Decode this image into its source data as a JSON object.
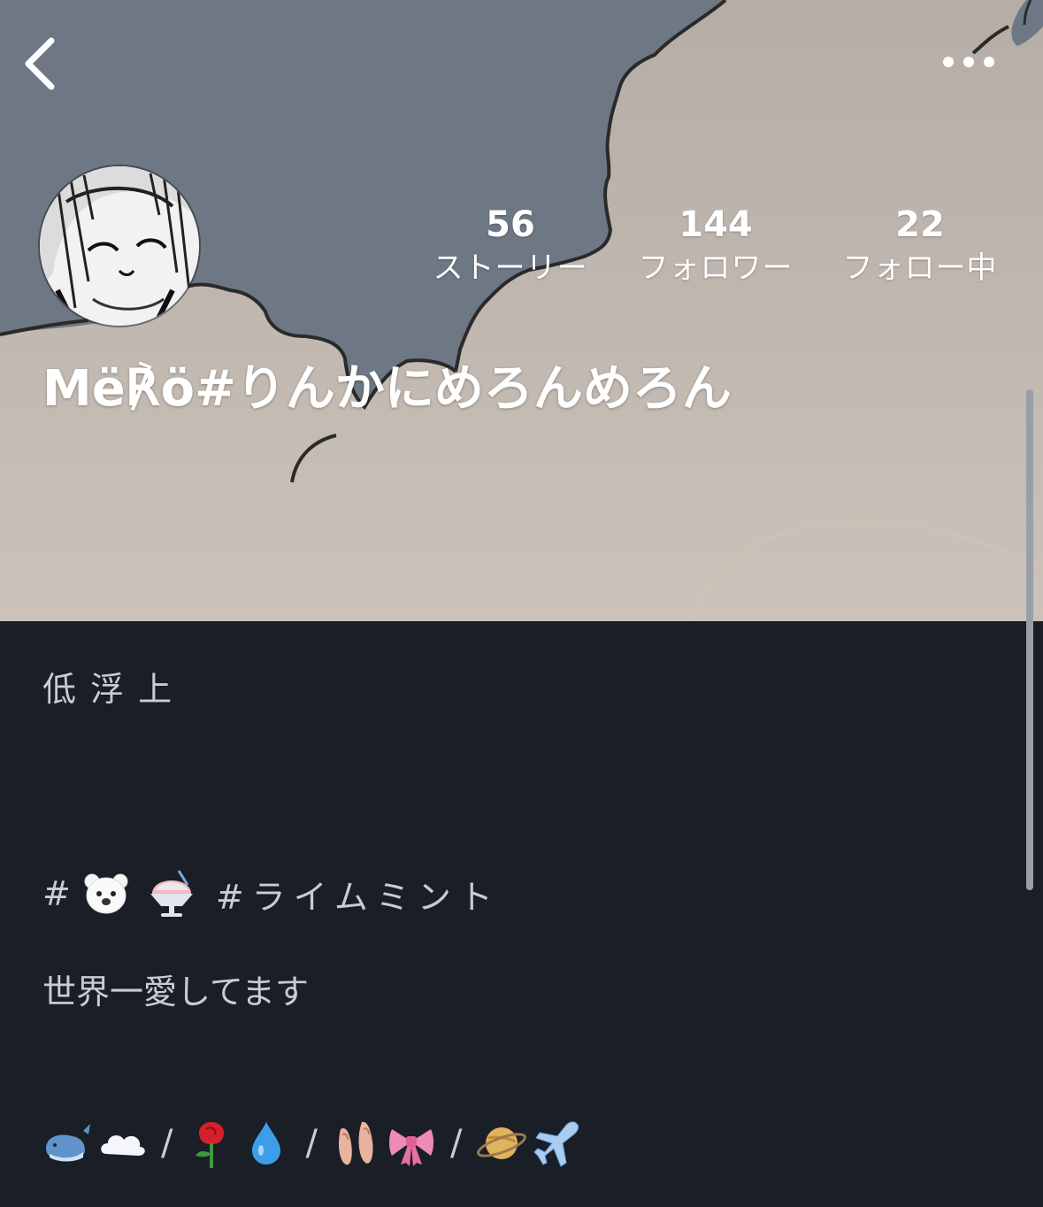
{
  "nav": {
    "back_icon": "chevron-left-icon",
    "more_icon": "ellipsis-icon"
  },
  "profile": {
    "username": "Më℟ö#りんかにめろんめろん",
    "avatar_icon": "manga-girl-avatar"
  },
  "stats": [
    {
      "value": "56",
      "label": "ストーリー"
    },
    {
      "value": "144",
      "label": "フォロワー"
    },
    {
      "value": "22",
      "label": "フォロー中"
    }
  ],
  "bio": {
    "line1": "低 浮 上",
    "tag_prefix": "#",
    "tag_text": "#ライムミント",
    "tag_emojis": [
      "polar-bear-icon",
      "shaved-ice-icon"
    ],
    "line3": "世界一愛してます",
    "emoji_groups": [
      [
        "whale-icon",
        "cloud-icon"
      ],
      [
        "rose-icon",
        "droplet-icon"
      ],
      [
        "ballet-shoes-icon",
        "ribbon-icon"
      ],
      [
        "ringed-planet-icon",
        "airplane-icon"
      ]
    ],
    "separator": "/"
  },
  "colors": {
    "background": "#1a1e26",
    "sky": "#6f7a86",
    "text": "#c9ccd1"
  }
}
